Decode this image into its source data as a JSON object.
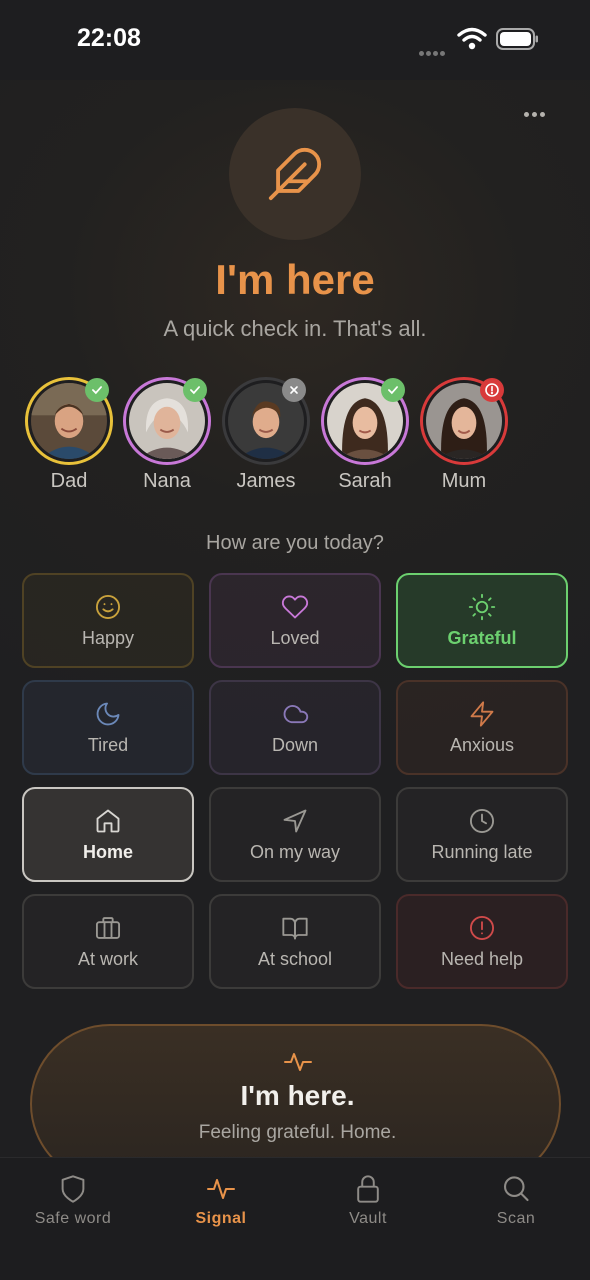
{
  "status_bar": {
    "time": "22:08"
  },
  "hero": {
    "title": "I'm here",
    "subtitle": "A quick check in. That's all.",
    "icon": "feather-icon"
  },
  "contacts": [
    {
      "name": "Dad",
      "ring_color": "#e8c13a",
      "status": "checked",
      "status_color": "#6cbf6a"
    },
    {
      "name": "Nana",
      "ring_color": "#c878d8",
      "status": "checked",
      "status_color": "#6cbf6a"
    },
    {
      "name": "James",
      "ring_color": "#3a3a3c",
      "status": "dismissed",
      "status_color": "#8a8a8a"
    },
    {
      "name": "Sarah",
      "ring_color": "#c878d8",
      "status": "checked",
      "status_color": "#6cbf6a"
    },
    {
      "name": "Mum",
      "ring_color": "#d83a3a",
      "status": "alert",
      "status_color": "#d83a3a"
    }
  ],
  "question": "How are you today?",
  "moods": [
    {
      "label": "Happy",
      "icon": "smile-icon",
      "color": "#c9a23c"
    },
    {
      "label": "Loved",
      "icon": "heart-icon",
      "color": "#c878d8"
    },
    {
      "label": "Grateful",
      "icon": "sun-icon",
      "color": "#6cd06f",
      "selected": true
    },
    {
      "label": "Tired",
      "icon": "moon-icon",
      "color": "#6b88b8"
    },
    {
      "label": "Down",
      "icon": "cloud-icon",
      "color": "#8a78b8"
    },
    {
      "label": "Anxious",
      "icon": "zap-icon",
      "color": "#d07a4a"
    },
    {
      "label": "Home",
      "icon": "home-icon",
      "color": "#d8d6d2",
      "selected": true
    },
    {
      "label": "On my way",
      "icon": "navigation-icon",
      "color": "#9a9893"
    },
    {
      "label": "Running late",
      "icon": "clock-icon",
      "color": "#9a9893"
    },
    {
      "label": "At work",
      "icon": "briefcase-icon",
      "color": "#9a9893"
    },
    {
      "label": "At school",
      "icon": "book-icon",
      "color": "#9a9893"
    },
    {
      "label": "Need help",
      "icon": "alert-circle-icon",
      "color": "#d04a4a"
    }
  ],
  "cta": {
    "title": "I'm here.",
    "subtitle": "Feeling grateful. Home.",
    "icon": "activity-icon",
    "accent": "#e8934a"
  },
  "tabs": [
    {
      "label": "Safe word",
      "icon": "shield-icon"
    },
    {
      "label": "Signal",
      "icon": "activity-icon",
      "active": true
    },
    {
      "label": "Vault",
      "icon": "lock-icon"
    },
    {
      "label": "Scan",
      "icon": "search-icon"
    }
  ]
}
